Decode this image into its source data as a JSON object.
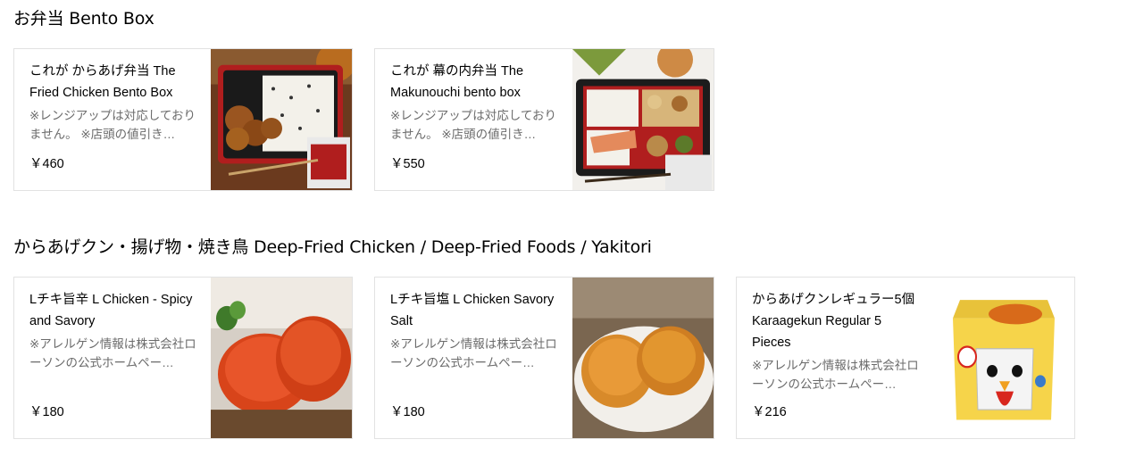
{
  "sections": [
    {
      "title": "お弁当 Bento Box",
      "items": [
        {
          "name": "これが からあげ弁当 The Fried Chicken Bento Box",
          "description": "※レンジアップは対応しておりません。 ※店頭の値引き…",
          "price": "￥460",
          "image_icon": "karaage-bento-photo"
        },
        {
          "name": "これが 幕の内弁当 The Makunouchi bento box",
          "description": "※レンジアップは対応しておりません。 ※店頭の値引き…",
          "price": "￥550",
          "image_icon": "makunouchi-bento-photo"
        }
      ]
    },
    {
      "title": "からあげクン・揚げ物・焼き鳥 Deep-Fried Chicken / Deep-Fried Foods / Yakitori",
      "items": [
        {
          "name": "Lチキ旨辛 L Chicken - Spicy and Savory",
          "description": "※アレルゲン情報は株式会社ローソンの公式ホームペー…",
          "price": "￥180",
          "image_icon": "spicy-fried-chicken-photo"
        },
        {
          "name": "Lチキ旨塩 L Chicken Savory Salt",
          "description": "※アレルゲン情報は株式会社ローソンの公式ホームペー…",
          "price": "￥180",
          "image_icon": "salt-fried-chicken-photo"
        },
        {
          "name": "からあげクンレギュラー5個 Karaagekun Regular 5 Pieces",
          "description": "※アレルゲン情報は株式会社ローソンの公式ホームペー…",
          "price": "￥216",
          "image_icon": "karaagekun-box-photo"
        }
      ]
    }
  ]
}
